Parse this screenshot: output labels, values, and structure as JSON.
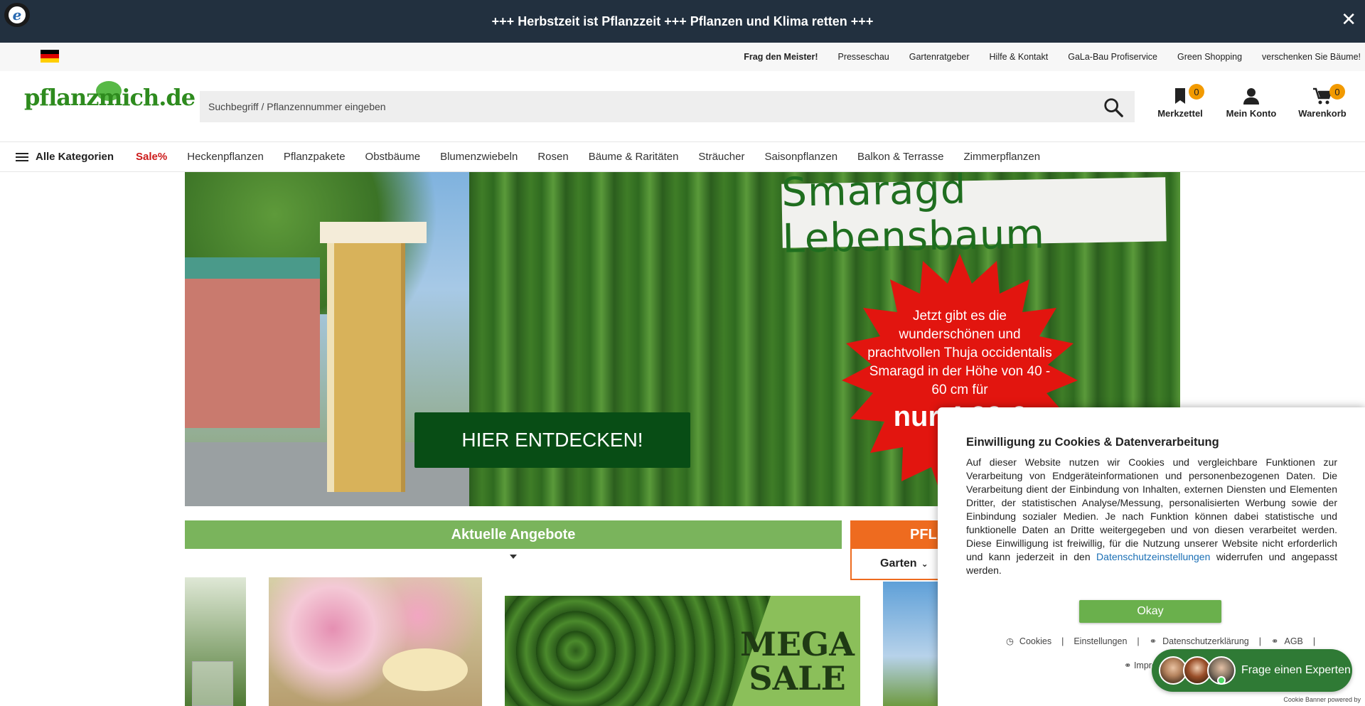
{
  "topbar": {
    "message": "+++ Herbstzeit ist Pflanzzeit +++ Pflanzen und Klima retten +++",
    "close_label": "✕"
  },
  "metabar": {
    "trusted_letter": "e",
    "links": [
      "Frag den Meister!",
      "Presseschau",
      "Gartenratgeber",
      "Hilfe & Kontakt",
      "GaLa-Bau Profiservice",
      "Green Shopping",
      "verschenken Sie Bäume!"
    ]
  },
  "header": {
    "logo": "pflanzmich.de",
    "search_placeholder": "Suchbegriff / Pflanzennummer eingeben",
    "merkzettel": {
      "label": "Merkzettel",
      "count": "0"
    },
    "konto": {
      "label": "Mein Konto"
    },
    "warenkorb": {
      "label": "Warenkorb",
      "count": "0"
    }
  },
  "nav": {
    "all_label": "Alle Kategorien",
    "sale_label": "Sale%",
    "items": [
      "Heckenpflanzen",
      "Pflanzpakete",
      "Obstbäume",
      "Blumenzwiebeln",
      "Rosen",
      "Bäume & Raritäten",
      "Sträucher",
      "Saisonpflanzen",
      "Balkon & Terrasse",
      "Zimmerpflanzen"
    ]
  },
  "hero": {
    "title": "Smaragd Lebensbaum",
    "star_text": "Jetzt gibt es die wunderschönen und prachtvollen Thuja occidentalis Smaragd in der Höhe von 40 - 60 cm für",
    "price": "nur 4,99 €",
    "cta": "HIER ENTDECKEN!"
  },
  "offers": {
    "label": "Aktuelle Angebote"
  },
  "pfl_tab": {
    "label": "PFL",
    "dropdown": "Garten"
  },
  "promo": {
    "mega": "MEGA",
    "sale": "SALE"
  },
  "cookie": {
    "title": "Einwilligung zu Cookies & Datenverarbeitung",
    "body_text": "Auf dieser Website nutzen wir Cookies und vergleichbare Funktionen zur Verarbeitung von Endgeräteinformationen und personenbezogenen Daten. Die Verarbeitung dient der Einbindung von Inhalten, externen Diensten und Elementen Dritter, der statistischen Analyse/Messung, personalisierten Werbung sowie der Einbindung sozialer Medien. Je nach Funktion können dabei statistische und funktionelle Daten an Dritte weitergegeben und von diesen verarbeitet werden. Diese Einwilligung ist freiwillig, für die Nutzung unserer Website nicht erforderlich und kann jederzeit in den",
    "body_link": "Datenschutzeinstellungen",
    "body_end": " widerrufen und angepasst werden.",
    "okay_label": "Okay",
    "links": [
      "Cookies",
      "Einstellungen",
      "Datenschutzerklärung",
      "AGB"
    ],
    "impressum": "Impressum",
    "powered_by": "Cookie Banner powered by"
  },
  "expert": {
    "label": "Frage einen Experten"
  },
  "colors": {
    "topbar": "#22303f",
    "brand_green": "#2e8b1e",
    "offers_green": "#7ab45c",
    "accent_orange": "#ee6b1f",
    "sale_red": "#cc1a1a",
    "badge": "#f29a00"
  }
}
